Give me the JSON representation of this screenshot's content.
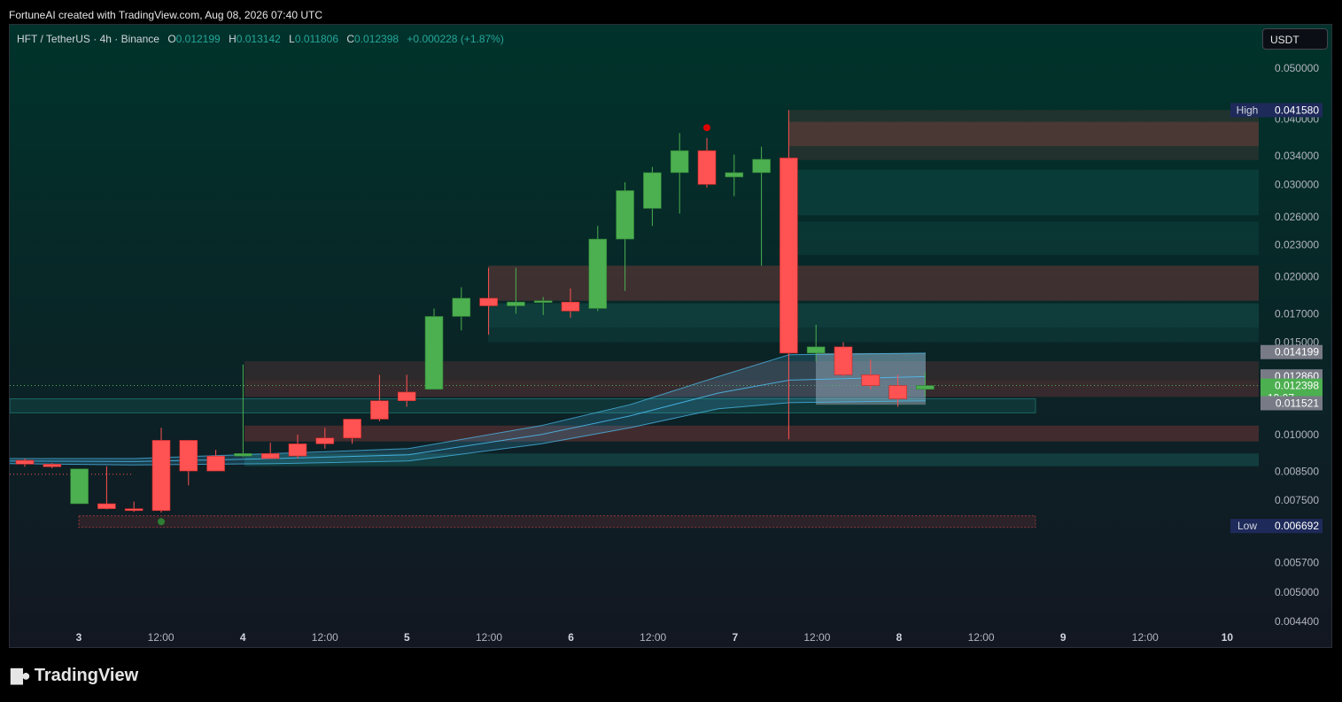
{
  "header": {
    "created_by": "FortuneAI created with TradingView.com, Aug 08, 2026 07:40 UTC"
  },
  "legend": {
    "symbol": "HFT / TetherUS · 4h · Binance",
    "o_label": "O",
    "o_value": "0.012199",
    "h_label": "H",
    "h_value": "0.013142",
    "l_label": "L",
    "l_value": "0.011806",
    "c_label": "C",
    "c_value": "0.012398",
    "change": "+0.000228 (+1.87%)"
  },
  "currency_button": "USDT",
  "brand": {
    "name": "TradingView"
  },
  "colors": {
    "up": "#4caf50",
    "down": "#ff5252",
    "band": "#4fc3f7",
    "bg_top": "#00332b",
    "bg_bottom": "#131722"
  },
  "chart_data": {
    "type": "candlestick",
    "interval": "4h",
    "y_ticks": [
      "0.050000",
      "0.040000",
      "0.034000",
      "0.030000",
      "0.026000",
      "0.023000",
      "0.020000",
      "0.017000",
      "0.015000",
      "0.010000",
      "0.008500",
      "0.007500",
      "0.005700",
      "0.005000",
      "0.004400"
    ],
    "x_ticks": [
      "3",
      "12:00",
      "4",
      "12:00",
      "5",
      "12:00",
      "6",
      "12:00",
      "7",
      "12:00",
      "8",
      "12:00",
      "9",
      "12:00",
      "10"
    ],
    "price_labels": [
      {
        "label": "High",
        "value": "0.041580",
        "type": "high"
      },
      {
        "label": "",
        "value": "0.014199",
        "type": "box"
      },
      {
        "label": "",
        "value": "0.012860",
        "type": "box"
      },
      {
        "label": "",
        "value": "0.012398",
        "sub": "19:07",
        "type": "last"
      },
      {
        "label": "",
        "value": "0.011521",
        "type": "box"
      },
      {
        "label": "Low",
        "value": "0.006692",
        "type": "low"
      }
    ],
    "candles": [
      {
        "o": 0.00893,
        "h": 0.009,
        "l": 0.00868,
        "c": 0.00878
      },
      {
        "o": 0.00878,
        "h": 0.00882,
        "l": 0.00862,
        "c": 0.00868
      },
      {
        "o": 0.00738,
        "h": 0.0086,
        "l": 0.00738,
        "c": 0.0086
      },
      {
        "o": 0.00738,
        "h": 0.0087,
        "l": 0.0072,
        "c": 0.00722
      },
      {
        "o": 0.00722,
        "h": 0.00745,
        "l": 0.00712,
        "c": 0.00716
      },
      {
        "o": 0.00975,
        "h": 0.0103,
        "l": 0.0071,
        "c": 0.00716
      },
      {
        "o": 0.00975,
        "h": 0.00975,
        "l": 0.008,
        "c": 0.00852
      },
      {
        "o": 0.0091,
        "h": 0.00935,
        "l": 0.00852,
        "c": 0.00852
      },
      {
        "o": 0.0091,
        "h": 0.0136,
        "l": 0.00905,
        "c": 0.0092
      },
      {
        "o": 0.0092,
        "h": 0.00965,
        "l": 0.009,
        "c": 0.009
      },
      {
        "o": 0.0096,
        "h": 0.01,
        "l": 0.009,
        "c": 0.0091
      },
      {
        "o": 0.00985,
        "h": 0.0103,
        "l": 0.0094,
        "c": 0.0096
      },
      {
        "o": 0.0107,
        "h": 0.0107,
        "l": 0.0096,
        "c": 0.00985
      },
      {
        "o": 0.0116,
        "h": 0.013,
        "l": 0.0106,
        "c": 0.0107
      },
      {
        "o": 0.01205,
        "h": 0.013,
        "l": 0.0113,
        "c": 0.0116
      },
      {
        "o": 0.0122,
        "h": 0.0174,
        "l": 0.0122,
        "c": 0.0168
      },
      {
        "o": 0.0168,
        "h": 0.0191,
        "l": 0.0158,
        "c": 0.0182
      },
      {
        "o": 0.0182,
        "h": 0.0208,
        "l": 0.0155,
        "c": 0.0176
      },
      {
        "o": 0.0176,
        "h": 0.0208,
        "l": 0.017,
        "c": 0.0179
      },
      {
        "o": 0.0179,
        "h": 0.0183,
        "l": 0.0169,
        "c": 0.018
      },
      {
        "o": 0.0179,
        "h": 0.019,
        "l": 0.0167,
        "c": 0.0172
      },
      {
        "o": 0.0174,
        "h": 0.025,
        "l": 0.0172,
        "c": 0.0236
      },
      {
        "o": 0.0236,
        "h": 0.0303,
        "l": 0.0188,
        "c": 0.0292
      },
      {
        "o": 0.027,
        "h": 0.0324,
        "l": 0.025,
        "c": 0.0316
      },
      {
        "o": 0.0316,
        "h": 0.0376,
        "l": 0.0264,
        "c": 0.0348
      },
      {
        "o": 0.0348,
        "h": 0.0368,
        "l": 0.0296,
        "c": 0.03
      },
      {
        "o": 0.031,
        "h": 0.0342,
        "l": 0.0285,
        "c": 0.0316
      },
      {
        "o": 0.0316,
        "h": 0.0354,
        "l": 0.021,
        "c": 0.0335
      },
      {
        "o": 0.0337,
        "h": 0.04158,
        "l": 0.0098,
        "c": 0.0143
      },
      {
        "o": 0.0143,
        "h": 0.0162,
        "l": 0.0138,
        "c": 0.0147
      },
      {
        "o": 0.0147,
        "h": 0.015,
        "l": 0.0129,
        "c": 0.013
      },
      {
        "o": 0.013,
        "h": 0.0139,
        "l": 0.0122,
        "c": 0.0124
      },
      {
        "o": 0.0124,
        "h": 0.013,
        "l": 0.0113,
        "c": 0.0117
      },
      {
        "o": 0.0122,
        "h": 0.01314,
        "l": 0.01181,
        "c": 0.0124
      }
    ]
  }
}
